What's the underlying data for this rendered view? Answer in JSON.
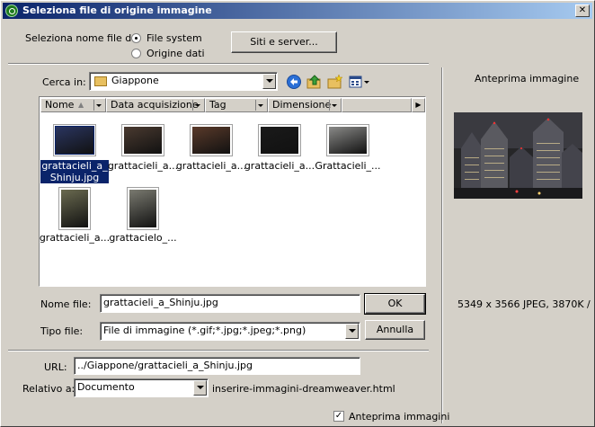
{
  "window": {
    "title": "Seleziona file di origine immagine"
  },
  "source": {
    "label": "Seleziona nome file da:",
    "options": [
      "File system",
      "Origine dati"
    ],
    "selected": "File system",
    "sites_button": "Siti e server..."
  },
  "lookin": {
    "label": "Cerca in:",
    "folder": "Giappone"
  },
  "columns": [
    "Nome",
    "Data acquisizione",
    "Tag",
    "Dimensione"
  ],
  "files": [
    {
      "name": "grattacieli_a_Shinju.jpg",
      "selected": true,
      "orientation": "landscape",
      "tone": "#2a3560"
    },
    {
      "name": "grattacieli_a...",
      "selected": false,
      "orientation": "landscape",
      "tone": "#4a3a30"
    },
    {
      "name": "grattacieli_a...",
      "selected": false,
      "orientation": "landscape",
      "tone": "#5a3a2a"
    },
    {
      "name": "grattacieli_a...",
      "selected": false,
      "orientation": "landscape",
      "tone": "#1a1a1a"
    },
    {
      "name": "Grattacieli_...",
      "selected": false,
      "orientation": "landscape",
      "tone": "#8a8a88"
    },
    {
      "name": "grattacieli_a...",
      "selected": false,
      "orientation": "portrait",
      "tone": "#6a6a50"
    },
    {
      "name": "grattacielo_...",
      "selected": false,
      "orientation": "portrait",
      "tone": "#7a7a70"
    }
  ],
  "filename": {
    "label": "Nome file:",
    "value": "grattacieli_a_Shinju.jpg"
  },
  "filetype": {
    "label": "Tipo file:",
    "value": "File di immagine (*.gif;*.jpg;*.jpeg;*.png)"
  },
  "ok_button": "OK",
  "cancel_button": "Annulla",
  "url": {
    "label": "URL:",
    "value": "../Giappone/grattacieli_a_Shinju.jpg"
  },
  "relative": {
    "label": "Relativo a:",
    "value": "Documento",
    "document": "inserire-immagini-dreamweaver.html"
  },
  "preview": {
    "title": "Anteprima immagine",
    "info": "5349 x 3566 JPEG, 3870K /",
    "checkbox_label": "Anteprima immagini",
    "checked": true
  }
}
